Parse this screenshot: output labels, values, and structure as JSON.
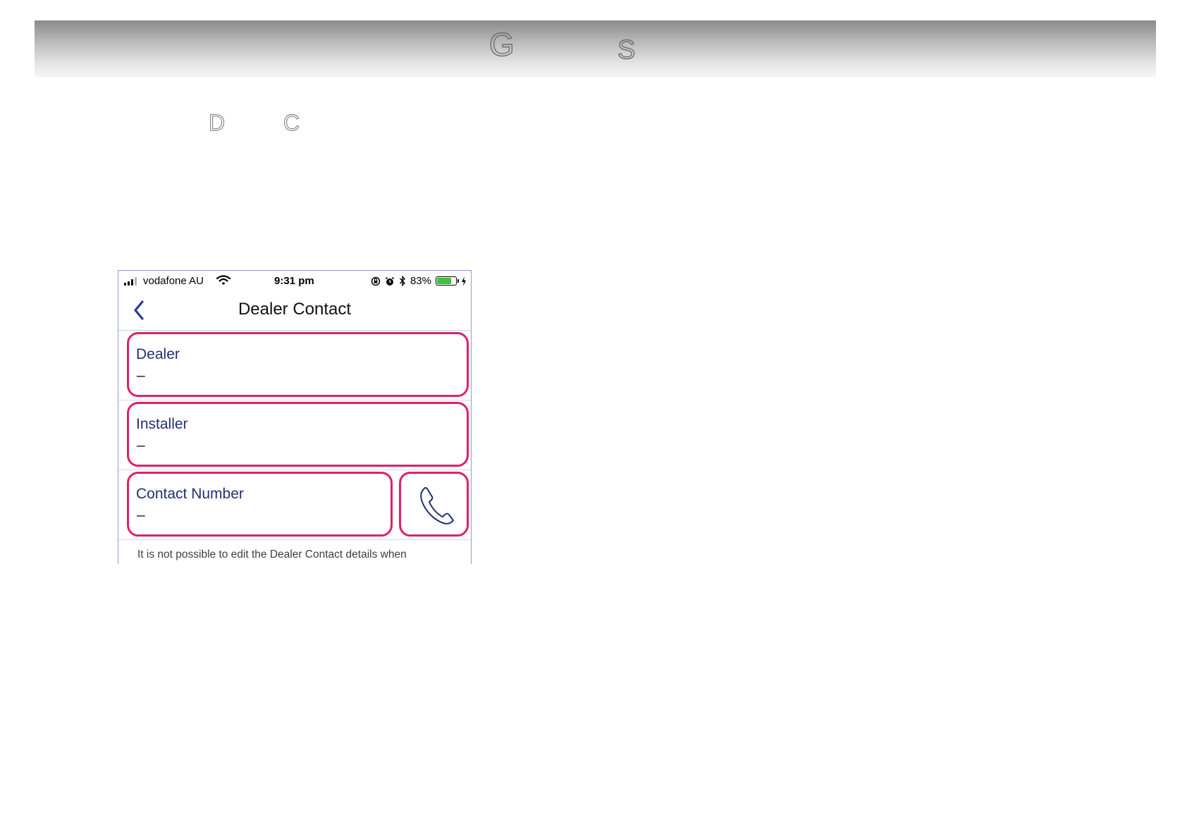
{
  "page": {
    "header_letters": [
      "G",
      "S"
    ],
    "heading_letters": [
      "D",
      "C"
    ]
  },
  "phone": {
    "status_bar": {
      "carrier": "vodafone AU",
      "time": "9:31 pm",
      "battery_percent": "83%",
      "battery_level": 0.83,
      "icons": [
        "signal-icon",
        "wifi-icon",
        "orientation-lock-icon",
        "alarm-icon",
        "bluetooth-icon",
        "battery-icon",
        "charging-icon"
      ]
    },
    "nav": {
      "title": "Dealer Contact",
      "back_icon": "chevron-left-icon"
    },
    "fields": [
      {
        "label": "Dealer",
        "value": "–"
      },
      {
        "label": "Installer",
        "value": "–"
      },
      {
        "label": "Contact Number",
        "value": "–"
      }
    ],
    "call_icon": "phone-icon",
    "footer_note": "It is not possible to edit the Dealer Contact details when"
  },
  "colors": {
    "highlight": "#e0206a",
    "label": "#24306e",
    "back_chevron": "#2b3a8f",
    "battery": "#3fc13f"
  }
}
